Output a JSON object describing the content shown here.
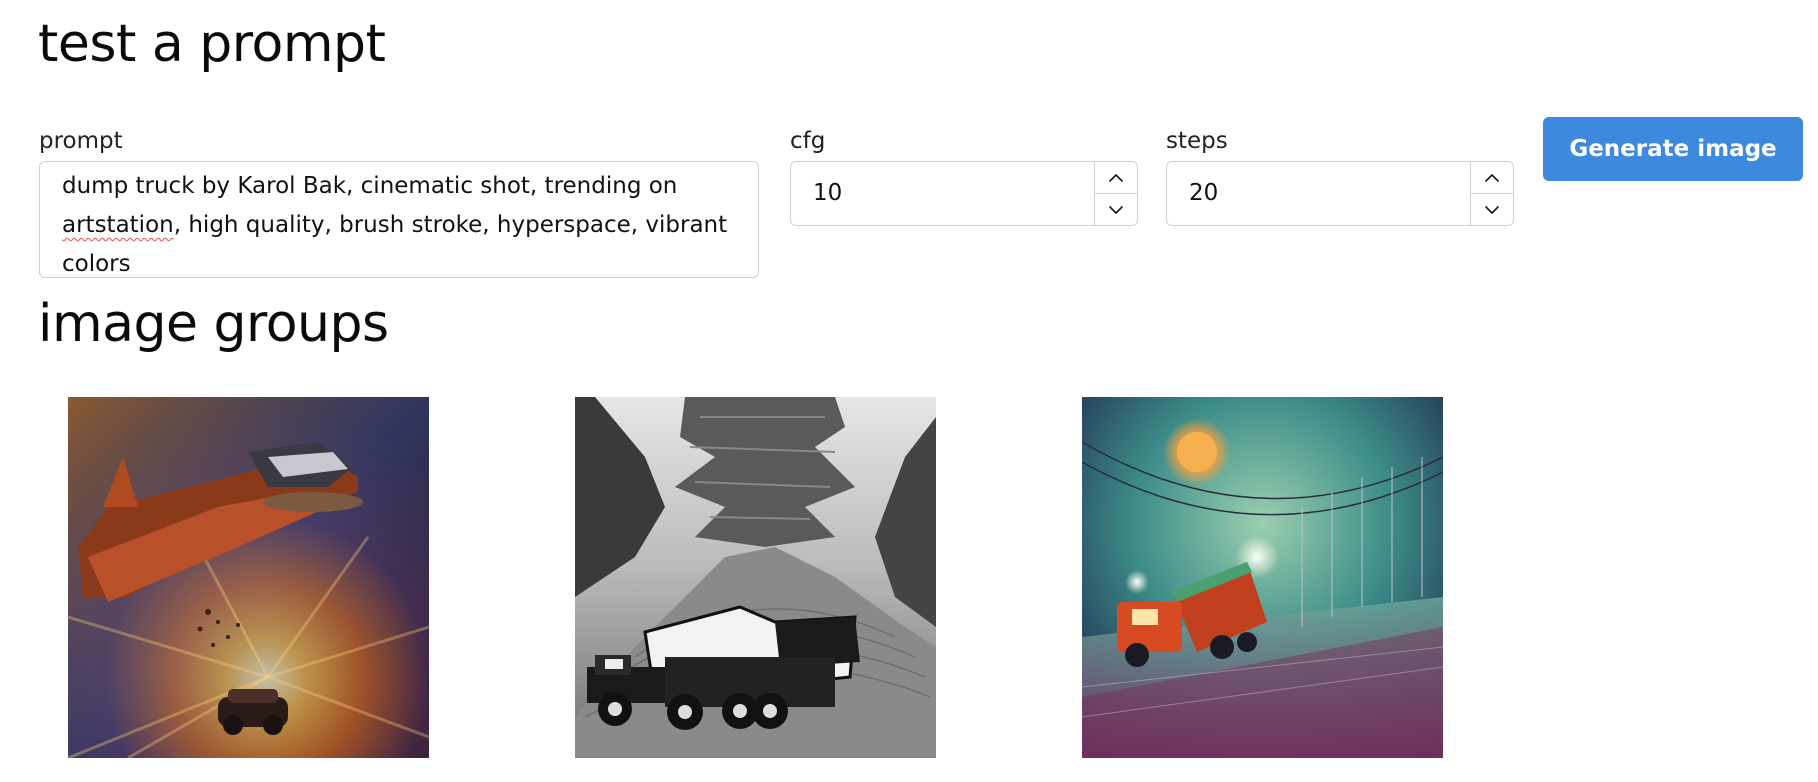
{
  "page": {
    "title": "test a prompt",
    "section_title": "image groups"
  },
  "form": {
    "prompt_label": "prompt",
    "prompt_value_start": "dump truck by Karol Bak, cinematic shot, trending on ",
    "prompt_value_misspelled": "artstation",
    "prompt_value_end": ", high quality, brush stroke, hyperspace, vibrant colors",
    "cfg_label": "cfg",
    "cfg_value": "10",
    "steps_label": "steps",
    "steps_value": "20",
    "generate_label": "Generate image",
    "accent_color": "#3d89dd"
  },
  "images": [
    {
      "name": "orange-flying-dump-truck-image"
    },
    {
      "name": "black-white-dump-truck-mountains-image"
    },
    {
      "name": "red-dump-truck-night-road-image"
    }
  ],
  "icons": {
    "step_up": "chevron-up-icon",
    "step_down": "chevron-down-icon"
  }
}
